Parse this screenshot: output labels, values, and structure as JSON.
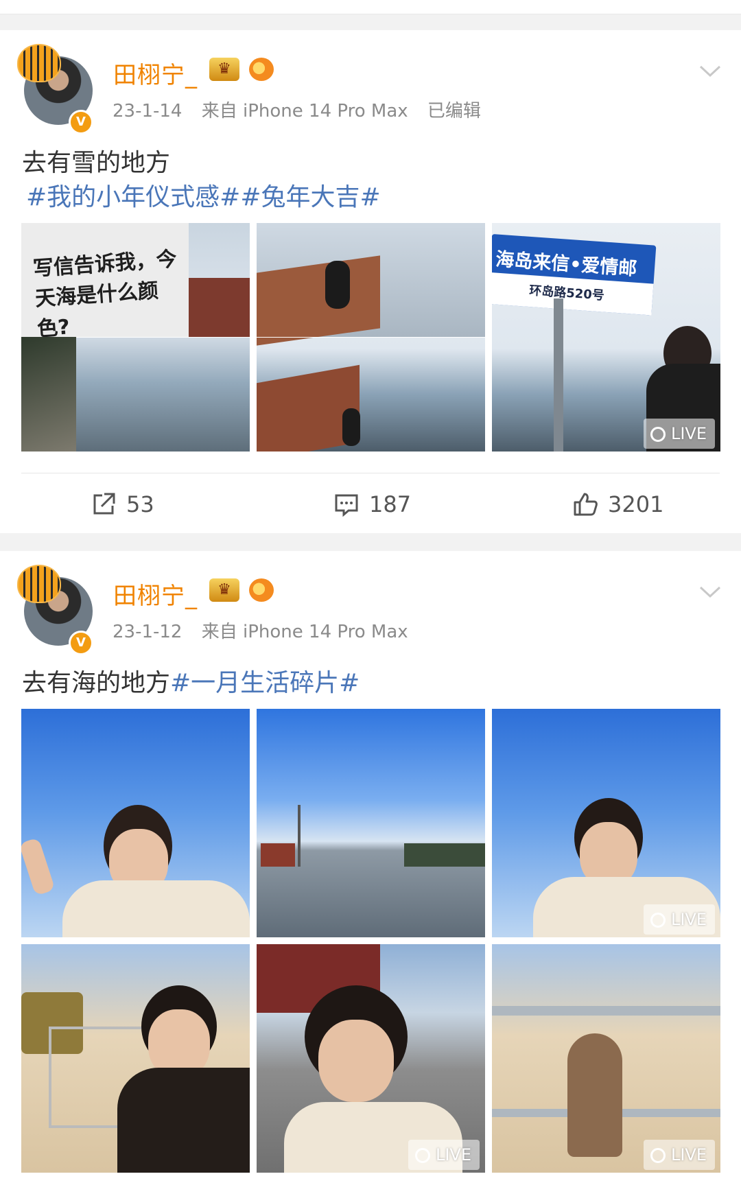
{
  "posts": [
    {
      "username": "田栩宁_",
      "verified_badge": "V",
      "date": "23-1-14",
      "source": "来自 iPhone 14 Pro Max",
      "edited": "已编辑",
      "text_line1": "去有雪的地方",
      "topics": "#我的小年仪式感##兔年大吉#",
      "images": [
        {
          "caption": "写信告诉我，今天海是什么颜色?"
        },
        {
          "caption": ""
        },
        {
          "caption": "海岛来信•爱情邮局",
          "caption2": "环岛路520号",
          "live": "LIVE"
        }
      ],
      "actions": {
        "share_icon": "share-icon",
        "share_count": "53",
        "comment_icon": "comment-icon",
        "comment_count": "187",
        "like_icon": "thumbs-up-icon",
        "like_count": "3201"
      }
    },
    {
      "username": "田栩宁_",
      "verified_badge": "V",
      "date": "23-1-12",
      "source": "来自 iPhone 14 Pro Max",
      "text_plain": "去有海的地方",
      "topic": "#一月生活碎片#",
      "live_labels": [
        "LIVE",
        "LIVE",
        "LIVE"
      ]
    }
  ],
  "colors": {
    "username": "#f08300",
    "topic": "#4a76b8",
    "meta": "#8a8a8a",
    "badge": "#f39c12"
  }
}
